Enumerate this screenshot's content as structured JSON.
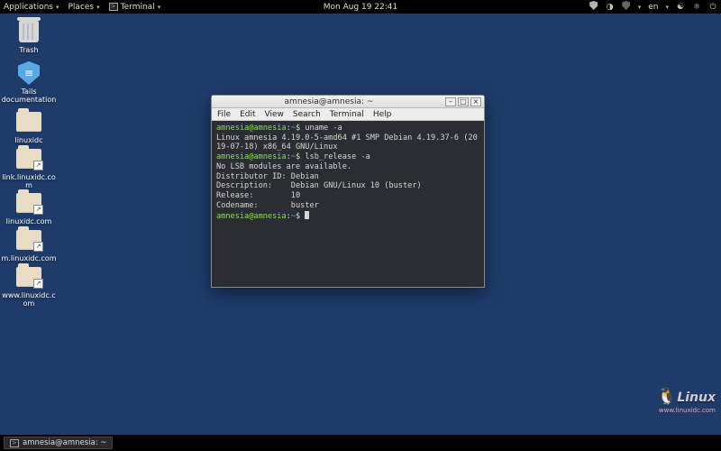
{
  "topbar": {
    "applications": "Applications",
    "places": "Places",
    "terminal": "Terminal",
    "clock": "Mon Aug 19  22:41",
    "lang": "en"
  },
  "desktop": {
    "trash": "Trash",
    "docs": "Tails\ndocumentation",
    "f1": "linuxidc",
    "f2": "link.linuxidc.co\nm",
    "f3": "linuxidc.com",
    "f4": "m.linuxidc.com",
    "f5": "www.linuxidc.c\nom"
  },
  "window": {
    "title": "amnesia@amnesia: ~",
    "menu": {
      "file": "File",
      "edit": "Edit",
      "view": "View",
      "search": "Search",
      "terminal": "Terminal",
      "help": "Help"
    },
    "btn_min": "–",
    "btn_max": "□",
    "btn_close": "×"
  },
  "term": {
    "prompt_user": "amnesia@amnesia",
    "prompt_path": "~",
    "cmd1": "uname -a",
    "out1": "Linux amnesia 4.19.0-5-amd64 #1 SMP Debian 4.19.37-6 (2019-07-18) x86_64 GNU/Linux",
    "cmd2": "lsb_release -a",
    "out2a": "No LSB modules are available.",
    "out2b": "Distributor ID:\tDebian",
    "out2c": "Description:\tDebian GNU/Linux 10 (buster)",
    "out2d": "Release:\t10",
    "out2e": "Codename:\tbuster"
  },
  "taskbar": {
    "entry": "amnesia@amnesia: ~"
  },
  "watermark": {
    "brand": "Linux",
    "url": "www.linuxidc.com"
  }
}
